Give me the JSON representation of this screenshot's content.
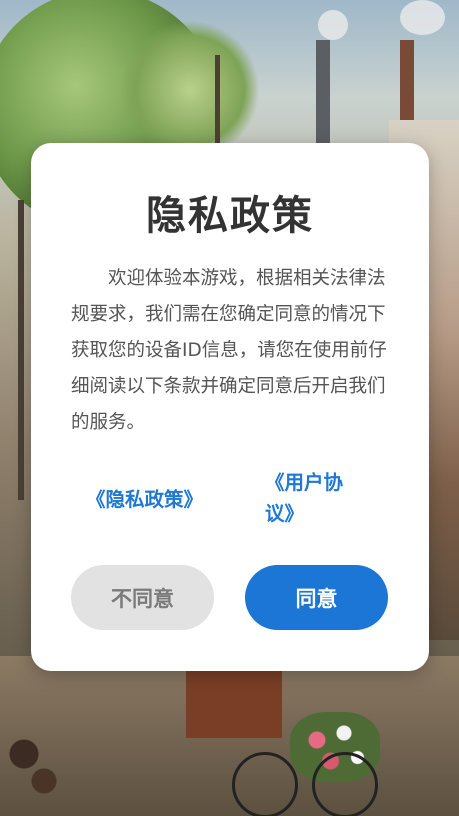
{
  "dialog": {
    "title": "隐私政策",
    "body": "欢迎体验本游戏，根据相关法律法规要求，我们需在您确定同意的情况下获取您的设备ID信息，请您在使用前仔细阅读以下条款并确定同意后开启我们的服务。",
    "privacy_link": "《隐私政策》",
    "terms_link": "《用户协议》",
    "disagree_button": "不同意",
    "agree_button": "同意"
  },
  "colors": {
    "accent": "#1b76d5",
    "link": "#1e78d4",
    "disagree_bg": "#e2e2e2"
  }
}
